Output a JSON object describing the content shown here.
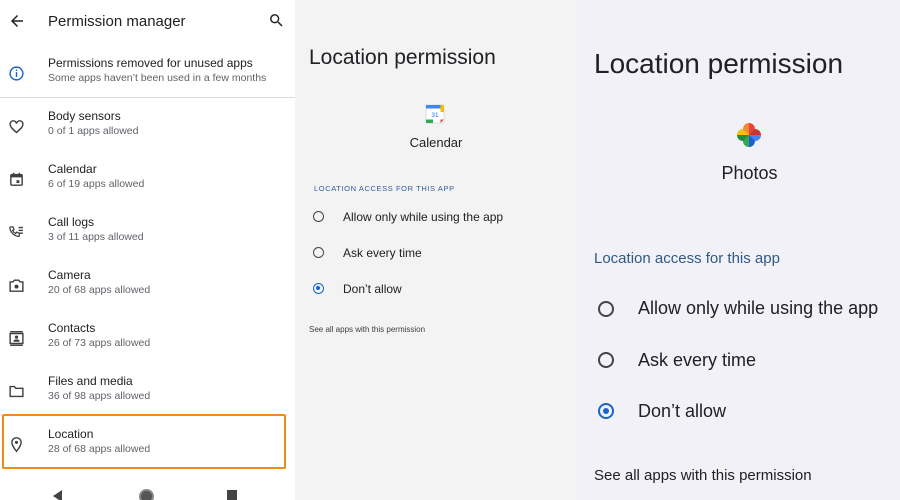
{
  "left": {
    "title": "Permission manager",
    "unused": {
      "title": "Permissions removed for unused apps",
      "subtitle": "Some apps haven’t been used in a few months"
    },
    "items": [
      {
        "label": "Body sensors",
        "count": "0 of 1 apps allowed",
        "icon": "heart-icon"
      },
      {
        "label": "Calendar",
        "count": "6 of 19 apps allowed",
        "icon": "calendar-icon"
      },
      {
        "label": "Call logs",
        "count": "3 of 11 apps allowed",
        "icon": "call-log-icon"
      },
      {
        "label": "Camera",
        "count": "20 of 68 apps allowed",
        "icon": "camera-icon"
      },
      {
        "label": "Contacts",
        "count": "26 of 73 apps allowed",
        "icon": "contacts-icon"
      },
      {
        "label": "Files and media",
        "count": "36 of 98 apps allowed",
        "icon": "folder-icon"
      },
      {
        "label": "Location",
        "count": "28 of 68 apps allowed",
        "icon": "location-icon"
      }
    ],
    "highlight_color": "#ef8a1a"
  },
  "middle": {
    "title": "Location permission",
    "app_name": "Calendar",
    "calendar_icon_text": "31",
    "section": "LOCATION ACCESS FOR THIS APP",
    "options": [
      "Allow only while using the app",
      "Ask every time",
      "Don’t allow"
    ],
    "selected_option": "Don’t allow",
    "link": "See all apps with this permission"
  },
  "right": {
    "title": "Location permission",
    "app_name": "Photos",
    "section": "Location access for this app",
    "options": [
      "Allow only while using the app",
      "Ask every time",
      "Don’t allow"
    ],
    "selected_option": "Don’t allow",
    "link": "See all apps with this permission"
  },
  "colors": {
    "accent": "#1a63c7",
    "section_text": "#2e5a8a"
  }
}
